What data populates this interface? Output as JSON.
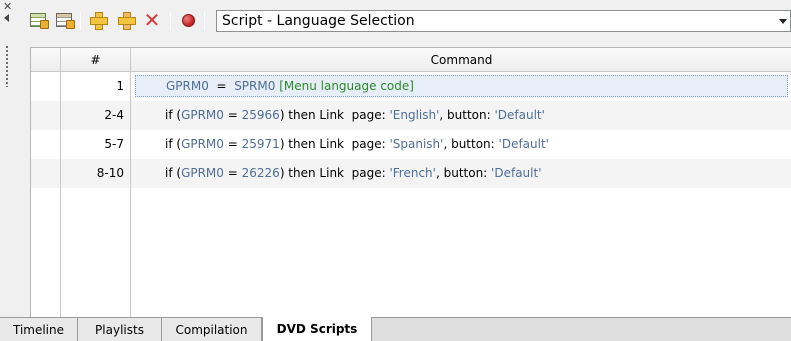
{
  "toolbar": {
    "buttons": [
      {
        "name": "table-add-icon"
      },
      {
        "name": "table-edit-icon"
      },
      {
        "name": "insert-command-icon"
      },
      {
        "name": "append-command-icon"
      },
      {
        "name": "delete-command-icon"
      },
      {
        "name": "record-icon"
      }
    ],
    "script_select": "Script - Language Selection"
  },
  "grid": {
    "headers": {
      "number": "#",
      "command": "Command"
    },
    "rows": [
      {
        "num": "1",
        "parts": [
          {
            "t": "GPRM0",
            "c": "reg"
          },
          {
            "t": "  =  ",
            "c": "kw"
          },
          {
            "t": "SPRM0",
            "c": "reg"
          },
          {
            "t": " [Menu language code]",
            "c": "cmt"
          }
        ],
        "selected": true
      },
      {
        "num": "2-4",
        "parts": [
          {
            "t": "if (",
            "c": "kw"
          },
          {
            "t": "GPRM0",
            "c": "reg"
          },
          {
            "t": " = ",
            "c": "kw"
          },
          {
            "t": "25966",
            "c": "reg"
          },
          {
            "t": ") then ",
            "c": "kw"
          },
          {
            "t": "Link",
            "c": "kw"
          },
          {
            "t": "  page: ",
            "c": "kw"
          },
          {
            "t": "'English'",
            "c": "str"
          },
          {
            "t": ", button: ",
            "c": "kw"
          },
          {
            "t": "'Default'",
            "c": "str"
          }
        ]
      },
      {
        "num": "5-7",
        "parts": [
          {
            "t": "if (",
            "c": "kw"
          },
          {
            "t": "GPRM0",
            "c": "reg"
          },
          {
            "t": " = ",
            "c": "kw"
          },
          {
            "t": "25971",
            "c": "reg"
          },
          {
            "t": ") then ",
            "c": "kw"
          },
          {
            "t": "Link",
            "c": "kw"
          },
          {
            "t": "  page: ",
            "c": "kw"
          },
          {
            "t": "'Spanish'",
            "c": "str"
          },
          {
            "t": ", button: ",
            "c": "kw"
          },
          {
            "t": "'Default'",
            "c": "str"
          }
        ]
      },
      {
        "num": "8-10",
        "parts": [
          {
            "t": "if (",
            "c": "kw"
          },
          {
            "t": "GPRM0",
            "c": "reg"
          },
          {
            "t": " = ",
            "c": "kw"
          },
          {
            "t": "26226",
            "c": "reg"
          },
          {
            "t": ") then ",
            "c": "kw"
          },
          {
            "t": "Link",
            "c": "kw"
          },
          {
            "t": "  page: ",
            "c": "kw"
          },
          {
            "t": "'French'",
            "c": "str"
          },
          {
            "t": ", button: ",
            "c": "kw"
          },
          {
            "t": "'Default'",
            "c": "str"
          }
        ]
      }
    ]
  },
  "tabs": [
    {
      "label": "Timeline",
      "active": false
    },
    {
      "label": "Playlists",
      "active": false
    },
    {
      "label": "Compilation",
      "active": false
    },
    {
      "label": "DVD Scripts",
      "active": true
    }
  ],
  "colors": {
    "register": "#4f6d9a",
    "comment": "#2c8a2c",
    "selection": "#e8eef7"
  }
}
